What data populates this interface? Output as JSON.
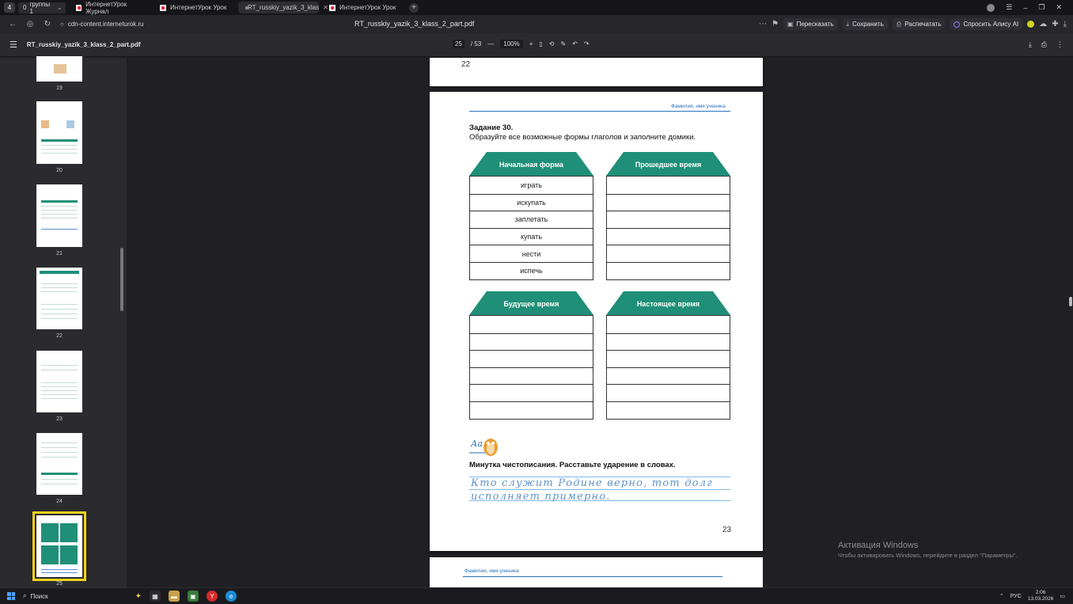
{
  "browser": {
    "tab_counter": "4",
    "group": {
      "count": "0",
      "label": "группы 1"
    },
    "tabs": [
      {
        "label": "ИнтернетУрок Журнал",
        "active": false,
        "favicon": "interneturok-icon"
      },
      {
        "label": "ИнтернетУрок Урок",
        "active": false,
        "favicon": "interneturok-icon"
      },
      {
        "label": "RT_russkiy_yazik_3_klas",
        "active": true,
        "favicon": "pdf-icon"
      },
      {
        "label": "ИнтернетУрок Урок",
        "active": false,
        "favicon": "interneturok-icon"
      }
    ],
    "url": "cdn-content.interneturok.ru",
    "page_title": "RT_russkiy_yazik_3_klass_2_part.pdf",
    "actions": {
      "retell": "Пересказать",
      "save": "Сохранить",
      "print": "Распечатать",
      "ask_alice": "Спросить Алису AI"
    }
  },
  "pdf_toolbar": {
    "filename": "RT_russkiy_yazik_3_klass_2_part.pdf",
    "current_page": "25",
    "total_pages": "/ 53",
    "zoom": "100%"
  },
  "sidebar": {
    "thumbnails": [
      {
        "page": "19",
        "selected": false
      },
      {
        "page": "20",
        "selected": false
      },
      {
        "page": "21",
        "selected": false
      },
      {
        "page": "22",
        "selected": false
      },
      {
        "page": "23",
        "selected": false
      },
      {
        "page": "24",
        "selected": false
      },
      {
        "page": "25",
        "selected": true
      }
    ]
  },
  "document": {
    "prev_page_number": "22",
    "name_label": "Фамилия, имя ученика",
    "task_title": "Задание 30.",
    "task_text": "Образуйте все возможные формы глаголов и заполните домики.",
    "houses": [
      {
        "title": "Начальная форма",
        "rows": [
          "играть",
          "искупать",
          "заплетать",
          "купать",
          "нести",
          "испечь"
        ]
      },
      {
        "title": "Прошедшее время",
        "rows": [
          "",
          "",
          "",
          "",
          "",
          ""
        ]
      },
      {
        "title": "Будущее время",
        "rows": [
          "",
          "",
          "",
          "",
          "",
          ""
        ]
      },
      {
        "title": "Настоящее время",
        "rows": [
          "",
          "",
          "",
          "",
          "",
          ""
        ]
      }
    ],
    "mascot_letters": "Аа",
    "calligraphy_title": "Минутка чистописания. Расставьте ударение в словах.",
    "calligraphy_line1": "Кто служит Родине верно, тот долг",
    "calligraphy_line2": "исполняет примерно.",
    "page_number": "23",
    "next_page_name_label": "Фамилия, имя ученика"
  },
  "activation": {
    "title": "Активация Windows",
    "subtitle": "Чтобы активировать Windows, перейдите в раздел \"Параметры\"."
  },
  "taskbar": {
    "search_label": "Поиск",
    "language": "РУС",
    "time": "2:06",
    "date": "13.03.2026"
  },
  "colors": {
    "house_green": "#1f8f78",
    "selection_yellow": "#f3d21b",
    "name_blue": "#2a6fb8"
  }
}
